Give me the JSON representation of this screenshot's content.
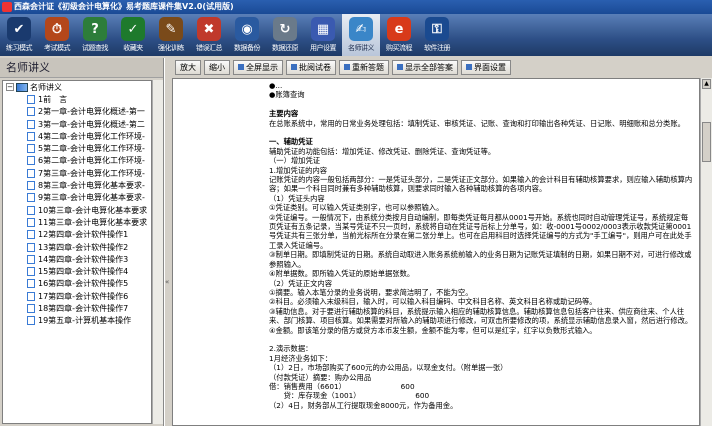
{
  "window": {
    "title": "西森会计证《初级会计电算化》易考题库课件集V2.0(试用版)"
  },
  "toolbar": {
    "items": [
      {
        "label": "练习模式",
        "icon": "practice-icon",
        "color": "#1a3a6e",
        "glyph": "✔"
      },
      {
        "label": "考试模式",
        "icon": "exam-icon",
        "color": "#b4471a",
        "glyph": "⏱"
      },
      {
        "label": "试题查找",
        "icon": "search-icon",
        "color": "#2d7d3a",
        "glyph": "?"
      },
      {
        "label": "收藏夹",
        "icon": "favorites-icon",
        "color": "#1e7a2c",
        "glyph": "✓"
      },
      {
        "label": "强化训练",
        "icon": "training-icon",
        "color": "#7a4a1a",
        "glyph": "✎"
      },
      {
        "label": "错误汇总",
        "icon": "error-summary-icon",
        "color": "#c0392b",
        "glyph": "✖"
      },
      {
        "label": "数据备份",
        "icon": "backup-icon",
        "color": "#2a5aa0",
        "glyph": "◉"
      },
      {
        "label": "数据还原",
        "icon": "restore-icon",
        "color": "#6a7a8a",
        "glyph": "↻"
      },
      {
        "label": "用户设置",
        "icon": "user-settings-icon",
        "color": "#3a5ab0",
        "glyph": "▦"
      },
      {
        "label": "名师讲义",
        "icon": "lecture-icon",
        "color": "#3a86c8",
        "glyph": "✍",
        "active": true
      },
      {
        "label": "购买流程",
        "icon": "purchase-icon",
        "color": "#d83a1a",
        "glyph": "e"
      },
      {
        "label": "软件注册",
        "icon": "register-icon",
        "color": "#1a4a90",
        "glyph": "⚿"
      }
    ]
  },
  "left_panel": {
    "title": "名师讲义",
    "root": "名师讲义",
    "items": [
      "1前　言",
      "2第一章-会计电算化概述-第一",
      "3第一章-会计电算化概述-第二",
      "4第二章-会计电算化工作环境-",
      "5第二章-会计电算化工作环境-",
      "6第二章-会计电算化工作环境-",
      "7第三章-会计电算化工作环境-",
      "8第三章-会计电算化基本要求-",
      "9第三章-会计电算化基本要求-",
      "10第三章-会计电算化基本要求",
      "11第三章-会计电算化基本要求",
      "12第四章-会计软件操作1",
      "13第四章-会计软件操作2",
      "14第四章-会计软件操作3",
      "15第四章-会计软件操作4",
      "16第四章-会计软件操作5",
      "17第四章-会计软件操作6",
      "18第四章-会计软件操作7",
      "19第五章-计算机基本操作"
    ]
  },
  "main_toolbar": {
    "buttons": [
      "放大",
      "缩小",
      "全屏显示",
      "批阅试卷",
      "重新答题",
      "显示全部答案",
      "界面设置"
    ]
  },
  "document": {
    "lines": [
      {
        "t": "●...",
        "b": false
      },
      {
        "t": "●账簿查询",
        "b": false
      },
      {
        "t": "",
        "b": false
      },
      {
        "t": "主要内容",
        "b": true
      },
      {
        "t": "在总账系统中，常用的日常业务处理包括：填制凭证、审核凭证、记账、查询和打印输出各种凭证、日记账、明细账和总分类账。",
        "b": false
      },
      {
        "t": "",
        "b": false
      },
      {
        "t": "一、辅助凭证",
        "b": true
      },
      {
        "t": "辅助凭证的功能包括：增加凭证、修改凭证、删除凭证、查询凭证等。",
        "b": false
      },
      {
        "t": "（一）增加凭证",
        "b": false
      },
      {
        "t": "1.增加凭证的内容",
        "b": false
      },
      {
        "t": "记账凭证的内容一般包括两部分：一是凭证头部分，二是凭证正文部分。如果输入的会计科目有辅助核算要求，则应输入辅助核算内容；如果一个科目同时兼有多种辅助核算，则要求同时输入各种辅助核算的各项内容。",
        "b": false
      },
      {
        "t": "（1）凭证头内容",
        "b": false
      },
      {
        "t": "①凭证类别。可以输入凭证类别字，也可以参照输入。",
        "b": false
      },
      {
        "t": "②凭证编号。一般情况下，由系统分类按月自动编制，即每类凭证每月都从0001号开始。系统也同时自动管理凭证号，系统规定每页凭证有五条记录，当某号凭证不只一页时，系统将自动在凭证号后标上分单号，如：收-0001号0002/0003表示收款凭证第0001号凭证共有三张分单，当前光标所在分录在第二张分单上。也可在启用科目时选择凭证编号的方式为\"手工编号\"，则用户可在此处手工录入凭证编号。",
        "b": false
      },
      {
        "t": "③制单日期。即填制凭证的日期。系统自动取进入账务系统前输入的业务日期为记账凭证填制的日期，如果日期不对，可进行修改或参照输入。",
        "b": false
      },
      {
        "t": "④附单据数。即所输入凭证的原始单据张数。",
        "b": false
      },
      {
        "t": "（2）凭证正文内容",
        "b": false
      },
      {
        "t": "①摘要。输入本笔分录的业务说明，要求简洁明了，不能为空。",
        "b": false
      },
      {
        "t": "②科目。必须输入末级科目，输入时，可以输入科目编码、中文科目名称、英文科目名称或助记码等。",
        "b": false
      },
      {
        "t": "③辅助信息。对于要进行辅助核算的科目，系统提示输入相应的辅助核算信息。辅助核算信息包括客户往来、供应商往来、个人往来、部门核算、项目核算。如果需要对所输入的辅助项进行修改，可双击所要修改的项，系统显示辅助信息录入窗，然后进行修改。",
        "b": false
      },
      {
        "t": "④金额。即该笔分录的借方或贷方本币发生额，金额不能为零，但可以是红字，红字以负数形式输入。",
        "b": false
      },
      {
        "t": "",
        "b": false
      },
      {
        "t": "2.演示数据：",
        "b": false
      },
      {
        "t": "1月经济业务如下：",
        "b": false
      },
      {
        "t": "（1）2日，市场部购买了600元的办公用品，以现金支付。（附单据一张）",
        "b": false
      },
      {
        "t": "（付款凭证）摘要：购办公用品",
        "b": false
      },
      {
        "t": "借：销售费用（6601）　　　　　　　　600",
        "b": false
      },
      {
        "t": "　　贷：库存现金（1001）　　　　　　　　600",
        "b": false
      },
      {
        "t": "（2）4日，财务部从工行提取现金8000元，作为备用金。",
        "b": false
      }
    ]
  }
}
